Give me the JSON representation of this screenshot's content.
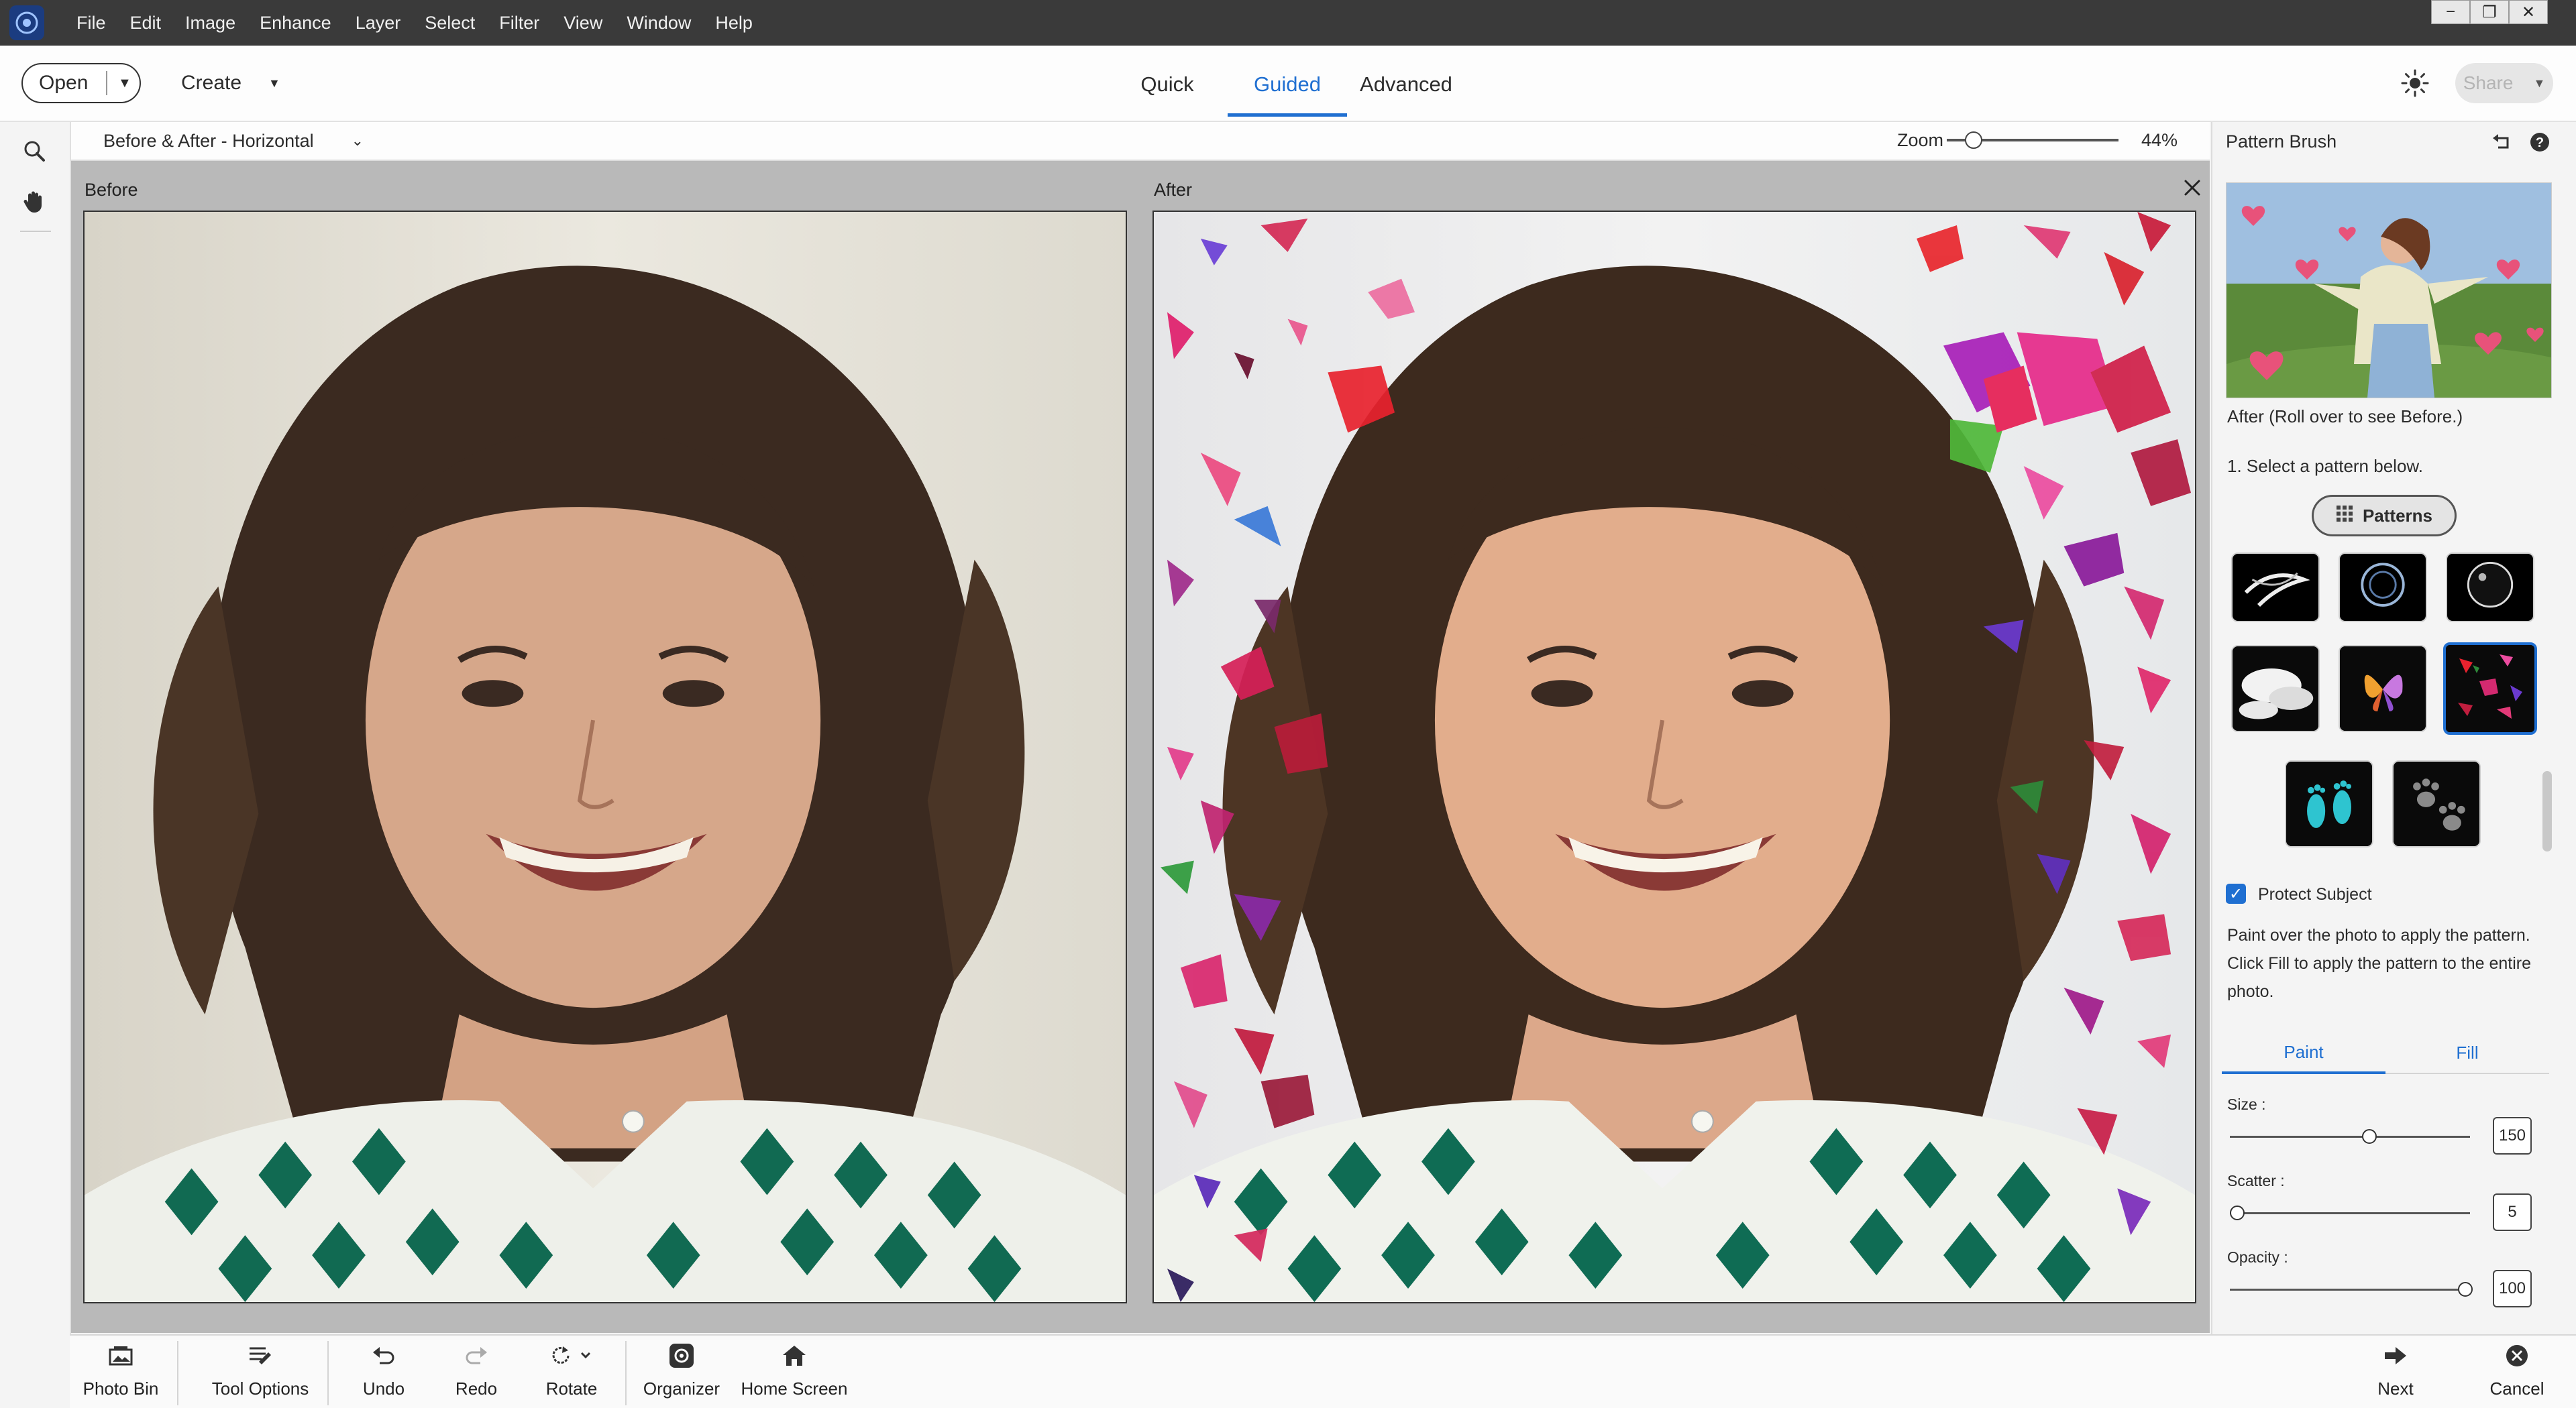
{
  "window": {
    "menu": [
      "File",
      "Edit",
      "Image",
      "Enhance",
      "Layer",
      "Select",
      "Filter",
      "View",
      "Window",
      "Help"
    ],
    "controls": {
      "minimize": "−",
      "restore": "❐",
      "close": "✕"
    }
  },
  "toolbar": {
    "open_label": "Open",
    "create_label": "Create",
    "modes": [
      "Quick",
      "Guided",
      "Advanced"
    ],
    "active_mode": "Guided",
    "share_label": "Share"
  },
  "view": {
    "layout_label": "Before & After - Horizontal",
    "zoom_label": "Zoom",
    "zoom_value": "44%",
    "zoom_fraction": 0.15
  },
  "canvas": {
    "before_label": "Before",
    "after_label": "After"
  },
  "panel": {
    "title": "Pattern Brush",
    "preview_caption": "After (Roll over to see Before.)",
    "step_text": "1. Select a pattern below.",
    "patterns_button": "Patterns",
    "pattern_thumbs": [
      "smoke-swirl",
      "ring-swirl",
      "bubble",
      "clouds",
      "butterfly",
      "confetti",
      "footprints",
      "paw-prints"
    ],
    "selected_pattern": "confetti",
    "protect_subject_label": "Protect Subject",
    "protect_subject_checked": true,
    "help_text": "Paint over the photo to apply the pattern. Click Fill to apply the pattern to the entire photo.",
    "tabs": [
      "Paint",
      "Fill"
    ],
    "active_tab": "Paint",
    "sliders": {
      "size": {
        "label": "Size :",
        "value": "150",
        "fraction": 0.58
      },
      "scatter": {
        "label": "Scatter :",
        "value": "5",
        "fraction": 0.03
      },
      "opacity": {
        "label": "Opacity :",
        "value": "100",
        "fraction": 0.98
      }
    }
  },
  "bottombar": {
    "photo_bin": "Photo Bin",
    "tool_options": "Tool Options",
    "undo": "Undo",
    "redo": "Redo",
    "rotate": "Rotate",
    "organizer": "Organizer",
    "home_screen": "Home Screen",
    "next": "Next",
    "cancel": "Cancel"
  },
  "colors": {
    "accent": "#1f6fd1",
    "titlebar": "#3a3a3a",
    "canvas_bg": "#b9b9b9"
  }
}
